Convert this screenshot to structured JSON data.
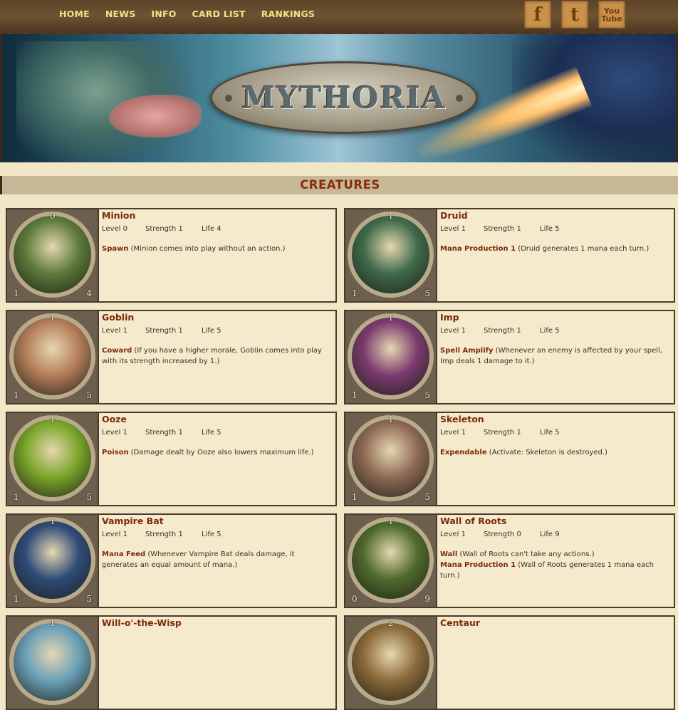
{
  "nav": [
    "HOME",
    "NEWS",
    "INFO",
    "CARD LIST",
    "RANKINGS"
  ],
  "social": {
    "facebook": "f",
    "twitter": "t",
    "youtube": "You Tube"
  },
  "logo_text": "MYTHORIA",
  "section_title": "CREATURES",
  "labels": {
    "level": "Level",
    "strength": "Strength",
    "life": "Life"
  },
  "cards": [
    {
      "name": "Minion",
      "level": "0",
      "strength": "1",
      "life": "4",
      "cost": "0",
      "bl": "1",
      "br": "4",
      "art": "#5d7a3a",
      "abilities": [
        {
          "name": "Spawn",
          "text": " (Minion comes into play without an action.)"
        }
      ]
    },
    {
      "name": "Druid",
      "level": "1",
      "strength": "1",
      "life": "5",
      "cost": "1",
      "bl": "1",
      "br": "5",
      "art": "#3f6a4a",
      "abilities": [
        {
          "name": "Mana Production 1",
          "text": " (Druid generates 1 mana each turn.)"
        }
      ]
    },
    {
      "name": "Goblin",
      "level": "1",
      "strength": "1",
      "life": "5",
      "cost": "1",
      "bl": "1",
      "br": "5",
      "art": "#b47d5a",
      "abilities": [
        {
          "name": "Coward",
          "text": " (If you have a higher morale, Goblin comes into play with its strength increased by 1.)"
        }
      ]
    },
    {
      "name": "Imp",
      "level": "1",
      "strength": "1",
      "life": "5",
      "cost": "1",
      "bl": "1",
      "br": "5",
      "art": "#7b3a6e",
      "abilities": [
        {
          "name": "Spell Amplify",
          "text": " (Whenever an enemy is affected by your spell, Imp deals 1 damage to it.)"
        }
      ]
    },
    {
      "name": "Ooze",
      "level": "1",
      "strength": "1",
      "life": "5",
      "cost": "1",
      "bl": "1",
      "br": "5",
      "art": "#7aa52a",
      "abilities": [
        {
          "name": "Poison",
          "text": " (Damage dealt by Ooze also lowers maximum life.)"
        }
      ]
    },
    {
      "name": "Skeleton",
      "level": "1",
      "strength": "1",
      "life": "5",
      "cost": "1",
      "bl": "1",
      "br": "5",
      "art": "#8e6a55",
      "abilities": [
        {
          "name": "Expendable",
          "text": " (Activate: Skeleton is destroyed.)"
        }
      ]
    },
    {
      "name": "Vampire Bat",
      "level": "1",
      "strength": "1",
      "life": "5",
      "cost": "1",
      "bl": "1",
      "br": "5",
      "art": "#2f4b78",
      "abilities": [
        {
          "name": "Mana Feed",
          "text": " (Whenever Vampire Bat deals damage, it generates an equal amount of mana.)"
        }
      ]
    },
    {
      "name": "Wall of Roots",
      "level": "1",
      "strength": "0",
      "life": "9",
      "cost": "1",
      "bl": "0",
      "br": "9",
      "art": "#4f6a2e",
      "abilities": [
        {
          "name": "Wall",
          "text": " (Wall of Roots can't take any actions.)"
        },
        {
          "name": "Mana Production 1",
          "text": " (Wall of Roots generates 1 mana each turn.)"
        }
      ]
    },
    {
      "name": "Will-o'-the-Wisp",
      "level": "",
      "strength": "",
      "life": "",
      "cost": "1",
      "bl": "",
      "br": "",
      "art": "#6aa0b8",
      "abilities": []
    },
    {
      "name": "Centaur",
      "level": "",
      "strength": "",
      "life": "",
      "cost": "2",
      "bl": "",
      "br": "",
      "art": "#8a6a3a",
      "abilities": []
    }
  ]
}
